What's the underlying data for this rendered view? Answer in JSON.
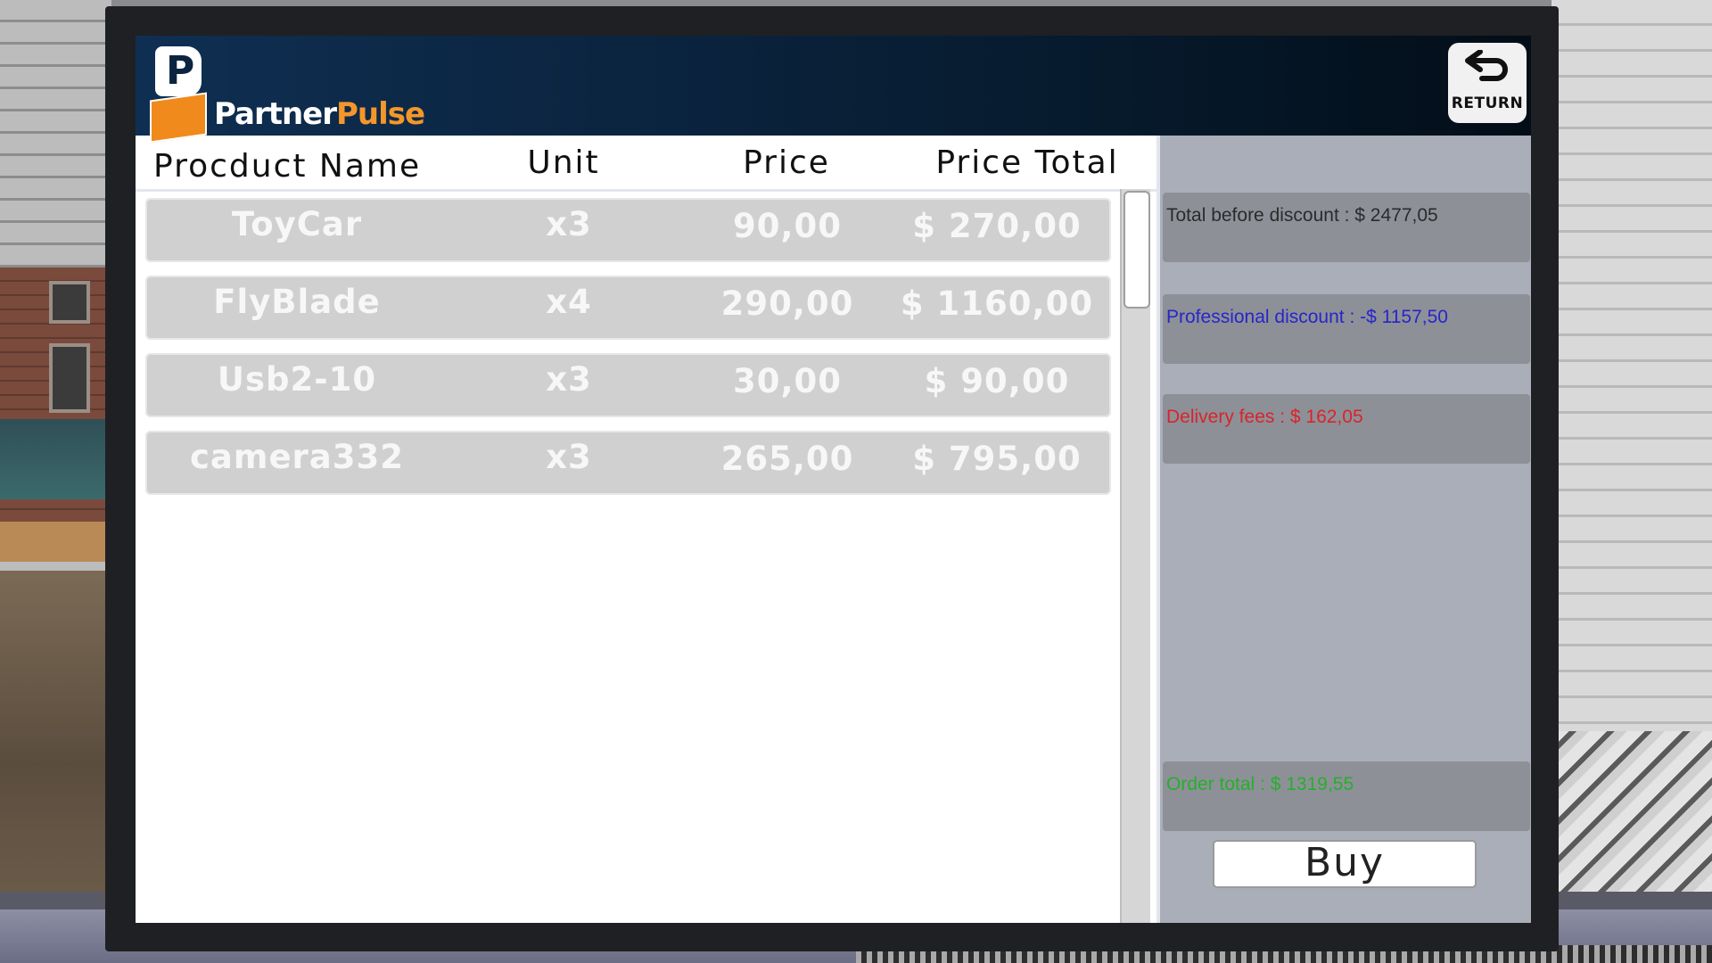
{
  "brand": {
    "logo_mark": "P",
    "name_part1": "Partner",
    "name_part2": "Pulse"
  },
  "return_button": {
    "label": "RETURN",
    "icon": "return-arrow-icon"
  },
  "table": {
    "columns": [
      "Procduct Name",
      "Unit",
      "Price",
      "Price Total"
    ],
    "rows": [
      {
        "name": "ToyCar",
        "unit": "x3",
        "price": "90,00",
        "total": "$ 270,00"
      },
      {
        "name": "FlyBlade",
        "unit": "x4",
        "price": "290,00",
        "total": "$ 1160,00"
      },
      {
        "name": "Usb2-10",
        "unit": "x3",
        "price": "30,00",
        "total": "$ 90,00"
      },
      {
        "name": "camera332",
        "unit": "x3",
        "price": "265,00",
        "total": "$ 795,00"
      }
    ]
  },
  "summary": {
    "total_before_discount": "Total before discount : $ 2477,05",
    "professional_discount": "Professional discount : -$ 1157,50",
    "delivery_fees": "Delivery fees : $ 162,05",
    "order_total": "Order total : $ 1319,55",
    "buy_label": "Buy"
  },
  "colors": {
    "total_before_discount": "#2b2b2b",
    "professional_discount": "#2626c8",
    "delivery_fees": "#d8242a",
    "order_total": "#25b02a",
    "header_dark": "#061a2c",
    "brand_orange": "#f5962a"
  }
}
